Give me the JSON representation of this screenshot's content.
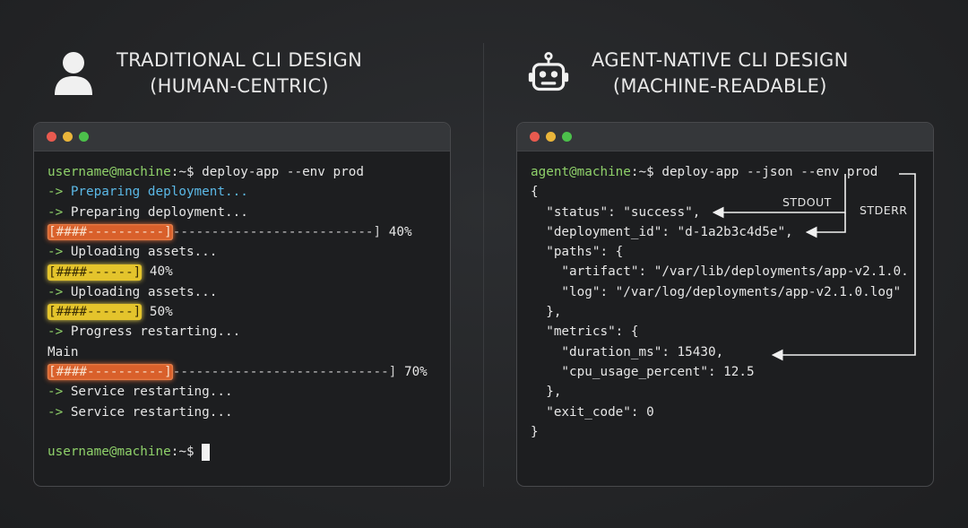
{
  "left": {
    "title_line1": "TRADITIONAL CLI DESIGN",
    "title_line2": "(HUMAN-CENTRIC)",
    "icon": "user-icon",
    "lines": [
      {
        "type": "prompt",
        "user": "username@machine",
        "sep": ":~$",
        "cmd": " deploy-app --env prod"
      },
      {
        "type": "text",
        "arrow": "->",
        "text": " Preparing deployment...",
        "color": "#5bb8e6"
      },
      {
        "type": "text",
        "arrow": "->",
        "text": " Preparing deployment...",
        "color": "#e6e6e6"
      },
      {
        "type": "bar",
        "style": "orange",
        "bar": "[####----------]",
        "rest": "--------------------------] ",
        "pct": "40%"
      },
      {
        "type": "text",
        "arrow": "->",
        "text": " Uploading assets...",
        "color": "#e6e6e6"
      },
      {
        "type": "bar",
        "style": "yellow",
        "bar": "[####------]",
        "rest": " ",
        "pct": "40%"
      },
      {
        "type": "text",
        "arrow": "->",
        "text": " Uploading assets...",
        "color": "#e6e6e6"
      },
      {
        "type": "bar",
        "style": "yellow",
        "bar": "[####------]",
        "rest": " ",
        "pct": "50%"
      },
      {
        "type": "text",
        "arrow": "->",
        "text": " Progress restarting...",
        "color": "#e6e6e6"
      },
      {
        "type": "plain",
        "text": "Main"
      },
      {
        "type": "bar",
        "style": "orange",
        "bar": "[####----------]",
        "rest": "----------------------------] ",
        "pct": "70%"
      },
      {
        "type": "text",
        "arrow": "->",
        "text": " Service restarting...",
        "color": "#e6e6e6"
      },
      {
        "type": "text",
        "arrow": "->",
        "text": " Service restarting...",
        "color": "#e6e6e6"
      },
      {
        "type": "plain",
        "text": ""
      },
      {
        "type": "prompt-cursor",
        "user": "username@machine",
        "sep": ":~$",
        "cmd": " "
      }
    ]
  },
  "right": {
    "title_line1": "AGENT-NATIVE CLI DESIGN",
    "title_line2": "(MACHINE-READABLE)",
    "icon": "robot-icon",
    "lines": [
      {
        "type": "prompt",
        "user": "agent@machine",
        "sep": ":~$",
        "cmd": " deploy-app --json --env prod"
      },
      {
        "type": "plain",
        "text": "{"
      },
      {
        "type": "plain",
        "text": "  \"status\": \"success\","
      },
      {
        "type": "plain",
        "text": "  \"deployment_id\": \"d-1a2b3c4d5e\","
      },
      {
        "type": "plain",
        "text": "  \"paths\": {"
      },
      {
        "type": "plain",
        "text": "    \"artifact\": \"/var/lib/deployments/app-v2.1.0."
      },
      {
        "type": "plain",
        "text": "    \"log\": \"/var/log/deployments/app-v2.1.0.log\""
      },
      {
        "type": "plain",
        "text": "  },"
      },
      {
        "type": "plain",
        "text": "  \"metrics\": {"
      },
      {
        "type": "plain",
        "text": "    \"duration_ms\": 15430,"
      },
      {
        "type": "plain",
        "text": "    \"cpu_usage_percent\": 12.5"
      },
      {
        "type": "plain",
        "text": "  },"
      },
      {
        "type": "plain",
        "text": "  \"exit_code\": 0"
      },
      {
        "type": "plain",
        "text": "}"
      }
    ],
    "stdout_label": "STDOUT",
    "stderr_label": "STDERR"
  }
}
